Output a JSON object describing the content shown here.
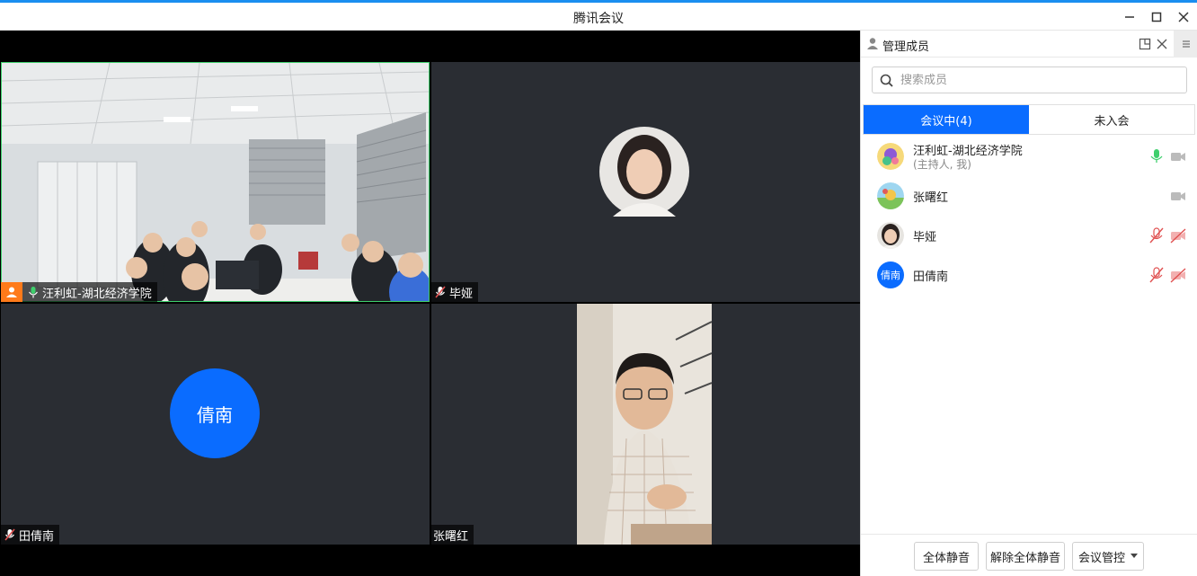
{
  "window": {
    "title": "腾讯会议"
  },
  "tiles": [
    {
      "name": "汪利虹-湖北经济学院",
      "mic": "on",
      "host": true,
      "speaking": true
    },
    {
      "name": "毕娅",
      "mic": "off"
    },
    {
      "name": "田倩南",
      "mic": "off",
      "avatar_text": "倩南"
    },
    {
      "name": "张曙红",
      "mic": "none"
    }
  ],
  "panel": {
    "title": "管理成员",
    "search_placeholder": "搜索成员",
    "tab_in_meeting": "会议中(4)",
    "tab_not_joined": "未入会",
    "members": [
      {
        "name": "汪利虹-湖北经济学院",
        "role": "(主持人, 我)",
        "mic": "on",
        "cam": "off-gray"
      },
      {
        "name": "张曙红",
        "cam": "off-gray"
      },
      {
        "name": "毕娅",
        "mic": "muted",
        "cam": "muted"
      },
      {
        "name": "田倩南",
        "avatar_text": "倩南",
        "mic": "muted",
        "cam": "muted"
      }
    ],
    "btn_mute_all": "全体静音",
    "btn_unmute_all": "解除全体静音",
    "btn_control": "会议管控"
  },
  "colors": {
    "accent": "#0a6cff",
    "host_badge": "#ff7a1a",
    "mic_on": "#3ecf6c",
    "muted": "#e05050"
  }
}
